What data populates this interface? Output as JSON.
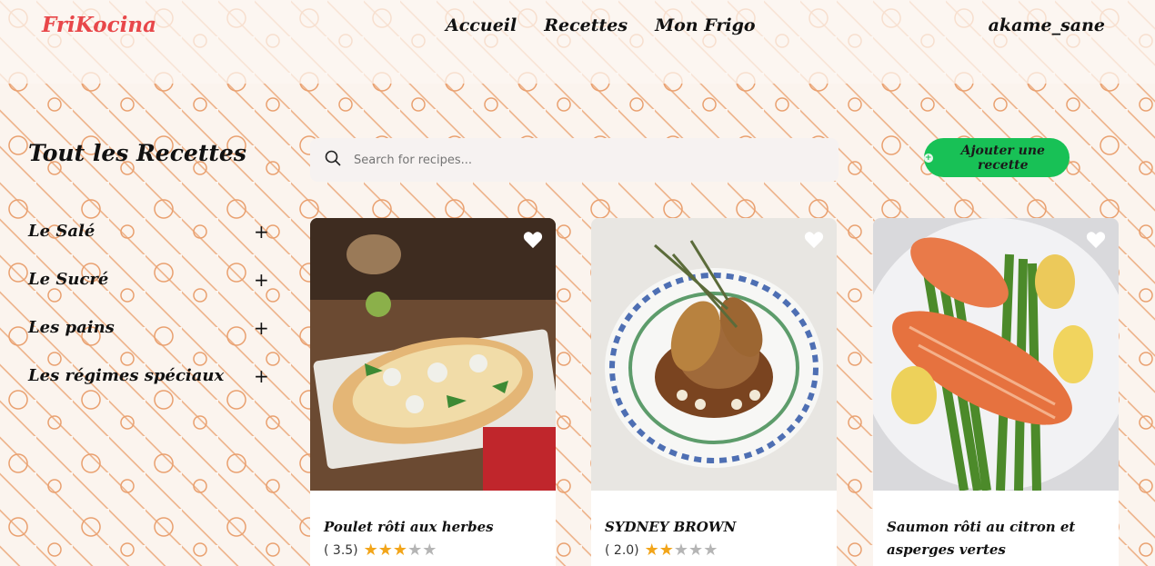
{
  "header": {
    "logo": "FriKocina",
    "nav": [
      "Accueil",
      "Recettes",
      "Mon Frigo"
    ],
    "user": "akame_sane"
  },
  "page": {
    "title": "Tout les Recettes",
    "categories": [
      "Le Salé",
      "Le Sucré",
      "Les pains",
      "Les régimes spéciaux"
    ],
    "category_icon": "plus-icon"
  },
  "search": {
    "placeholder": "Search for recipes..."
  },
  "add_button": {
    "label": "Ajouter une recette"
  },
  "recipes": [
    {
      "name": "Poulet rôti aux herbes",
      "rating_text": "( 3.5)",
      "rating": 3.5
    },
    {
      "name": "SYDNEY BROWN",
      "rating_text": "( 2.0)",
      "rating": 2.0
    },
    {
      "name": "Saumon rôti au citron et asperges vertes",
      "rating_text": "",
      "rating": null
    }
  ],
  "colors": {
    "brand": "#e8474a",
    "accent": "#18c156",
    "star": "#f2a51a"
  }
}
